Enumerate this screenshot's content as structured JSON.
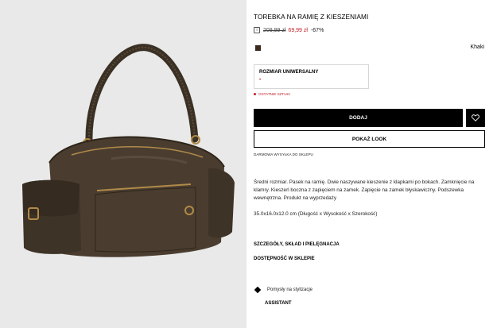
{
  "product": {
    "title": "TOREBKA NA RAMIĘ Z KIESZENIAMI",
    "info_icon": "info-icon",
    "old_price": "209,99 zł",
    "new_price": "69,99 zł",
    "discount": "-67%",
    "color_name": "Khaki",
    "swatch_color": "#3b2a1c",
    "size_label": "ROZMIAR UNIWERSALNY",
    "size_marker": "•",
    "stock_note": "OSTATNIE SZTUKI",
    "add_label": "DODAJ",
    "wishlist_icon": "heart-icon",
    "look_label": "POKAŻ LOOK",
    "shipping_note": "DARMOWA WYSYŁKA DO SKLEPU",
    "description": "Średni rozmiar. Pasek na ramię. Dwie naszywane kieszenie z klapkami po bokach. Zamknięcie na klamry. Kieszeń boczna z zapięciem na zamek. Zapięcie na zamek błyskawiczny. Podszewka wewnętrzna. Produkt na wyprzedaży",
    "dimensions": "35.0x16.0x12.0 cm (Długość x Wysokość x Szerokość)",
    "details_link": "SZCZEGÓŁY, SKŁAD I PIELĘGNACJA",
    "store_link": "DOSTĘPNOŚĆ W SKLEPIE",
    "assistant_hint": "Pomysły na stylizacje",
    "assistant_title": "ASSISTANT",
    "assistant_icon": "diamond-icon"
  },
  "colors": {
    "accent_red": "#c0202a",
    "button_black": "#000000",
    "image_background": "#e9e9e9"
  }
}
